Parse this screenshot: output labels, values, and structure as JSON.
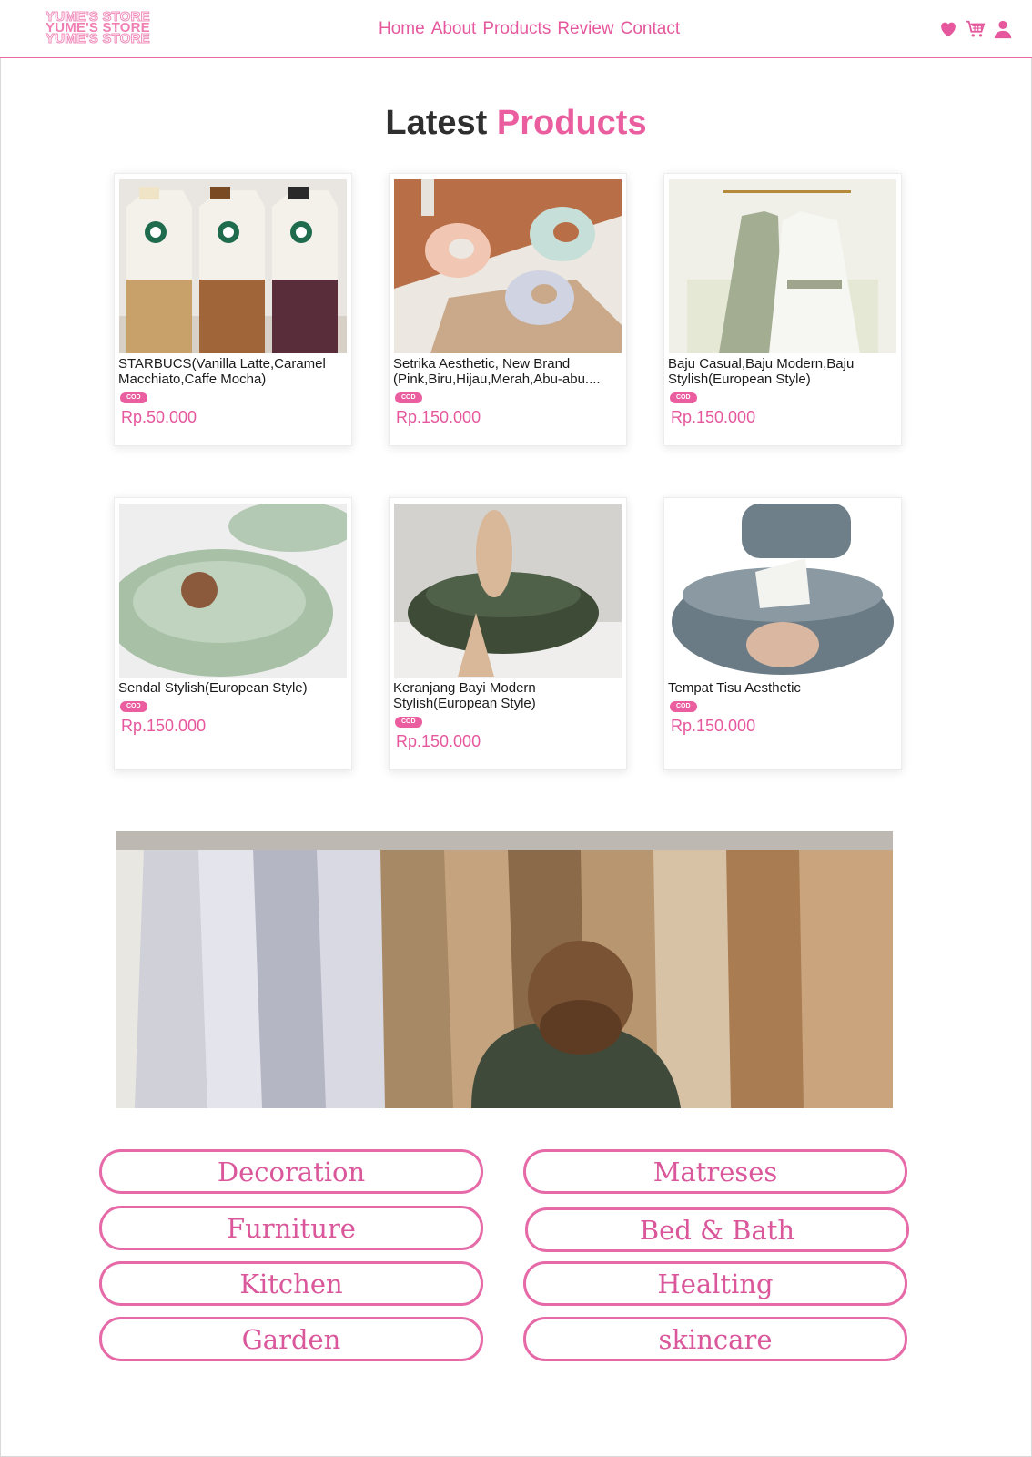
{
  "header": {
    "logo": [
      "YUME'S STORE",
      "YUME'S STORE",
      "YUME'S STORE"
    ],
    "nav": [
      "Home",
      "About",
      "Products",
      "Review",
      "Contact"
    ],
    "icons": [
      "heart-icon",
      "cart-icon",
      "user-icon"
    ]
  },
  "section_title": {
    "part1": "Latest",
    "part2": "Products"
  },
  "products": [
    {
      "name": "STARBUCS(Vanilla Latte,Caramel Macchiato,Caffe Mocha)",
      "badge": "COD",
      "price": "Rp.50.000"
    },
    {
      "name": "Setrika Aesthetic, New Brand (Pink,Biru,Hijau,Merah,Abu-abu....",
      "badge": "COD",
      "price": "Rp.150.000"
    },
    {
      "name": "Baju Casual,Baju Modern,Baju Stylish(European Style)",
      "badge": "COD",
      "price": "Rp.150.000"
    },
    {
      "name": "Sendal Stylish(European Style)",
      "badge": "COD",
      "price": "Rp.150.000"
    },
    {
      "name": "Keranjang Bayi Modern Stylish(European Style)",
      "badge": "COD",
      "price": "Rp.150.000"
    },
    {
      "name": "Tempat Tisu Aesthetic",
      "badge": "COD",
      "price": "Rp.150.000"
    }
  ],
  "categories": [
    "Decoration",
    "Matreses",
    "Furniture",
    "Bed & Bath",
    "Kitchen",
    "Healting",
    "Garden",
    "skincare"
  ],
  "colors": {
    "accent": "#ea5d9f",
    "title_dark": "#2f2f2f",
    "border": "#e56aa7"
  }
}
